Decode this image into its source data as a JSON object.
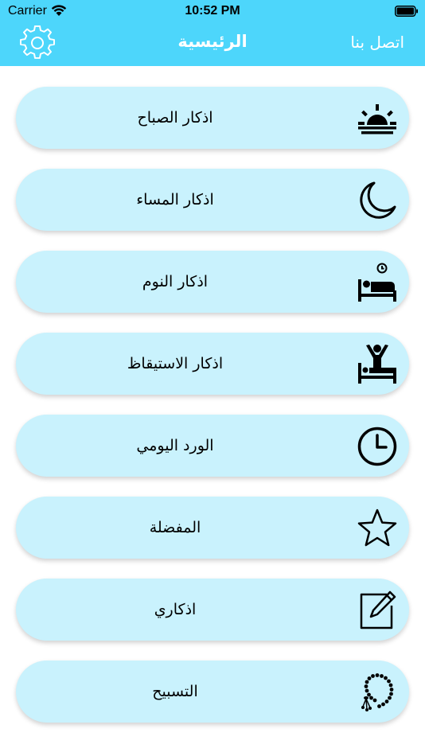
{
  "status_bar": {
    "carrier": "Carrier",
    "time": "10:52 PM"
  },
  "nav": {
    "title": "الرئيسية",
    "contact_label": "اتصل بنا",
    "settings_icon": "gear-icon"
  },
  "colors": {
    "header": "#4dd6fb",
    "item_background": "#c9f2fd"
  },
  "menu": {
    "items": [
      {
        "label": "اذكار الصباح",
        "icon": "sunrise-icon"
      },
      {
        "label": "اذكار المساء",
        "icon": "moon-icon"
      },
      {
        "label": "اذكار النوم",
        "icon": "sleeping-bed-icon"
      },
      {
        "label": "اذكار الاستيقاظ",
        "icon": "waking-up-icon"
      },
      {
        "label": "الورد اليومي",
        "icon": "clock-icon"
      },
      {
        "label": "المفضلة",
        "icon": "star-icon"
      },
      {
        "label": "اذكاري",
        "icon": "edit-note-icon"
      },
      {
        "label": "التسبيح",
        "icon": "prayer-beads-icon"
      }
    ]
  }
}
